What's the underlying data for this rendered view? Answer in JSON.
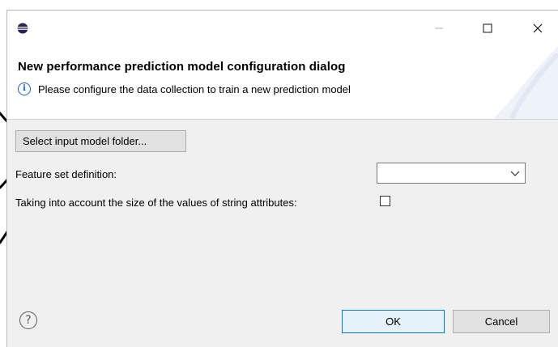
{
  "window": {
    "title_bar": {
      "minimize_icon": "minimize-icon",
      "maximize_icon": "maximize-icon",
      "close_icon": "close-icon",
      "app_icon": "eclipse-icon"
    }
  },
  "banner": {
    "title": "New performance prediction model configuration dialog",
    "message": "Please configure the data collection to train a new prediction model",
    "info_icon": "info-icon",
    "info_glyph": "i"
  },
  "form": {
    "select_folder_label": "Select input model folder...",
    "feature_set_label": "Feature set definition:",
    "feature_set_value": "",
    "string_size_label": "Taking into account the size of the values of string attributes:",
    "string_size_checked": false
  },
  "footer": {
    "help_glyph": "?",
    "ok_label": "OK",
    "cancel_label": "Cancel"
  },
  "colors": {
    "dialog_bg": "#f0f0f0",
    "ok_border": "#0078d7",
    "info_blue": "#1f5fb5"
  }
}
